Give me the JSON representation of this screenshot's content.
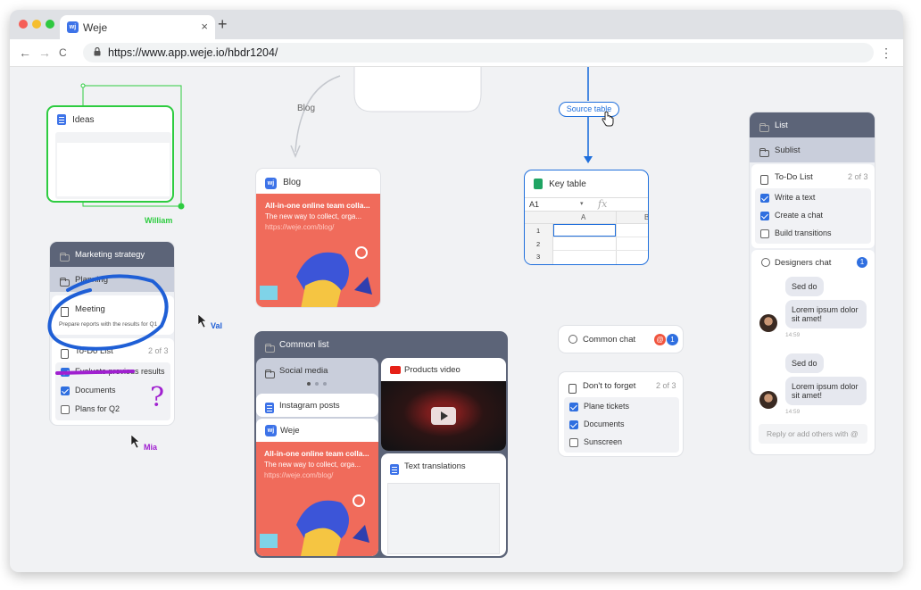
{
  "browser": {
    "tab_title": "Weje",
    "tab_close": "×",
    "new_tab": "+",
    "url": "https://www.app.weje.io/hbdr1204/",
    "back": "←",
    "forward": "→",
    "reload": "C",
    "menu": "⋮"
  },
  "logo_text": "wj",
  "cards": {
    "ideas": {
      "title": "Ideas"
    },
    "blog_connector_label": "Blog",
    "source_table_label": "Source table",
    "blog": {
      "title": "Blog",
      "headline": "All-in-one online team colla...",
      "subline": "The new way to collect, orga...",
      "link": "https://weje.com/blog/"
    },
    "key_table": {
      "title": "Key table",
      "cell_ref": "A1",
      "fx": "fx",
      "col_a": "A",
      "col_b": "B",
      "rows": [
        "1",
        "2",
        "3"
      ]
    },
    "marketing": {
      "title": "Marketing strategy",
      "planning": "Planning",
      "meeting": "Meeting",
      "meeting_note": "Prepare reports with the results for Q1",
      "todo_title": "To-Do List",
      "todo_count": "2 of 3",
      "items": [
        "Evaluate previous results",
        "Documents",
        "Plans for Q2"
      ],
      "question_mark": "?"
    },
    "common_list": {
      "title": "Common list",
      "social_media": "Social media",
      "instagram": "Instagram posts",
      "weje": "Weje",
      "headline": "All-in-one online team colla...",
      "subline": "The new way to collect, orga...",
      "link": "https://weje.com/blog/",
      "products_video": "Products video",
      "text_translations": "Text translations"
    },
    "common_chat": {
      "title": "Common chat",
      "mention": "@",
      "badge": "1"
    },
    "dont_forget": {
      "title": "Don't to forget",
      "count": "2 of 3",
      "items": [
        "Plane tickets",
        "Documents",
        "Sunscreen"
      ]
    },
    "list": {
      "title": "List",
      "sublist": "Sublist",
      "todo_title": "To-Do List",
      "todo_count": "2 of 3",
      "items": [
        "Write a text",
        "Create a chat",
        "Build transitions"
      ],
      "chat_title": "Designers chat",
      "chat_badge": "1",
      "messages": [
        {
          "short": "Sed do",
          "long": "Lorem ipsum dolor sit amet!",
          "time": "14:59"
        },
        {
          "short": "Sed do",
          "long": "Lorem ipsum dolor sit amet!",
          "time": "14:59"
        }
      ],
      "reply_placeholder": "Reply or add others with @"
    }
  },
  "cursors": {
    "william": "William",
    "val": "Val",
    "mia": "Mia"
  },
  "colors": {
    "accent_blue": "#2f6fe0",
    "header_slate": "#5c6478",
    "sub_slate": "#c9cedb",
    "cursor_green": "#2ecc40",
    "cursor_blue": "#1f5fd6",
    "cursor_purple": "#a020d0"
  }
}
